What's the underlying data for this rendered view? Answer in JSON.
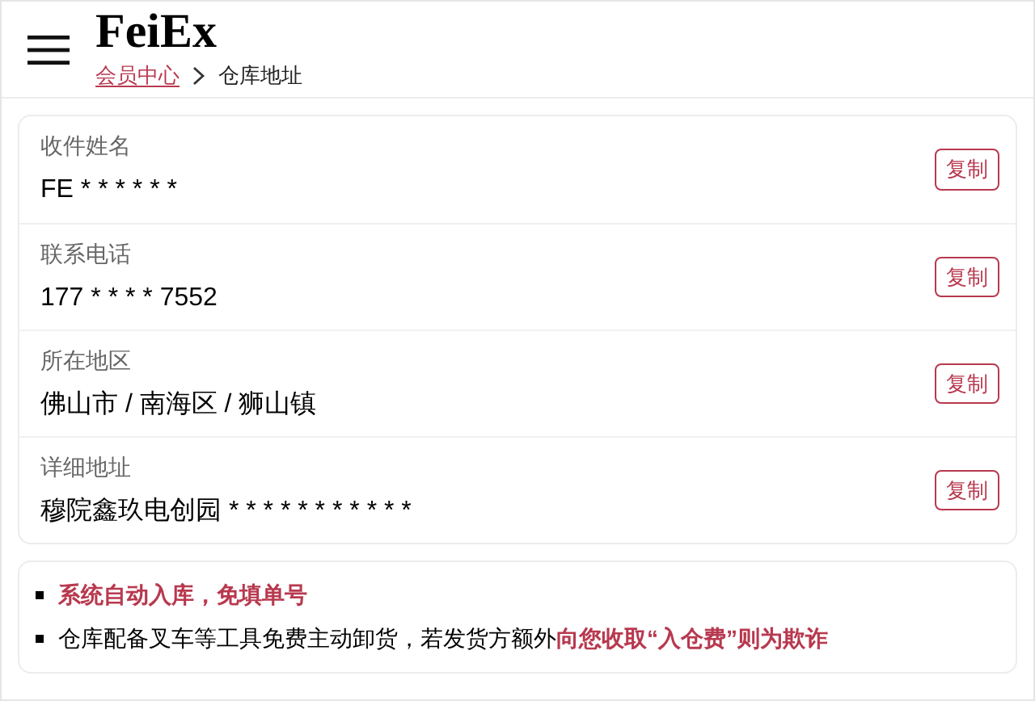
{
  "header": {
    "logo": "FeiEx",
    "breadcrumb": [
      {
        "label": "会员中心",
        "link": true
      },
      {
        "label": "仓库地址",
        "link": false
      }
    ]
  },
  "fields": [
    {
      "label": "收件姓名",
      "value": "FE * * * * * *",
      "button": "复制"
    },
    {
      "label": "联系电话",
      "value": "177 * * * * 7552",
      "button": "复制"
    },
    {
      "label": "所在地区",
      "value": "佛山市 / 南海区 / 狮山镇",
      "button": "复制"
    },
    {
      "label": "详细地址",
      "value": "穆院鑫玖电创园 * * * * * * * * * * *",
      "button": "复制"
    }
  ],
  "notes": [
    {
      "segments": [
        {
          "text": "系统自动入库，免填单号",
          "highlight": true
        }
      ]
    },
    {
      "segments": [
        {
          "text": "仓库配备叉车等工具免费主动卸货，若发货方额外",
          "highlight": false
        },
        {
          "text": "向您收取“入仓费”则为欺诈",
          "highlight": true
        }
      ]
    }
  ]
}
